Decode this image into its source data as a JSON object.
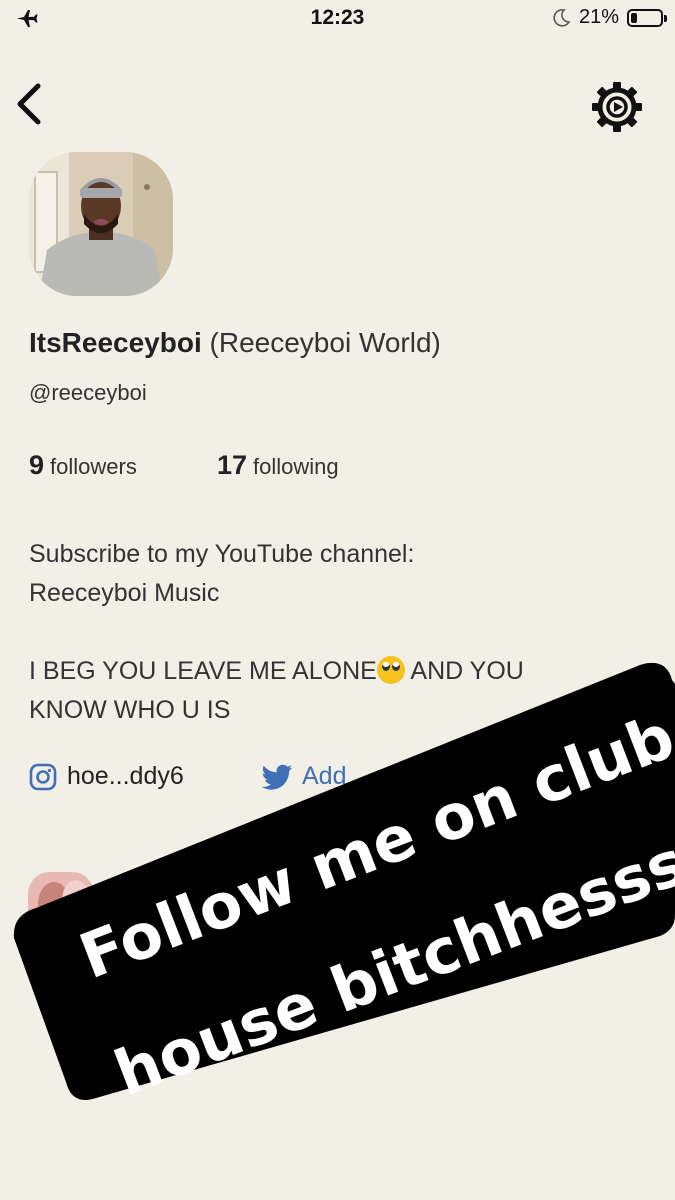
{
  "status_bar": {
    "time": "12:23",
    "battery_text": "21%",
    "battery_level": 0.21
  },
  "profile": {
    "name": "ItsReeceyboi",
    "name_suffix": "(Reeceyboi World)",
    "username": "@reeceyboi",
    "followers_count": "9",
    "followers_label": "followers",
    "following_count": "17",
    "following_label": "following",
    "bio_line1": "Subscribe to my YouTube channel:",
    "bio_line2": "Reeceyboi Music",
    "bio_line3a": "I BEG YOU LEAVE ME ALONE",
    "bio_line3b": " AND YOU",
    "bio_line4": "KNOW WHO U IS",
    "instagram_handle": "hoe...ddy6",
    "twitter_label": "Add"
  },
  "overlay": {
    "line1": "Follow me on club",
    "line2": "house bitchhessss"
  },
  "colors": {
    "background": "#f2efe6",
    "twitter_blue": "#3f6fb4",
    "banner": "#000000"
  },
  "icons": [
    "airplane-icon",
    "moon-icon",
    "battery-icon",
    "back-arrow-icon",
    "settings-gear-icon",
    "instagram-icon",
    "twitter-icon",
    "eye-roll-emoji"
  ]
}
